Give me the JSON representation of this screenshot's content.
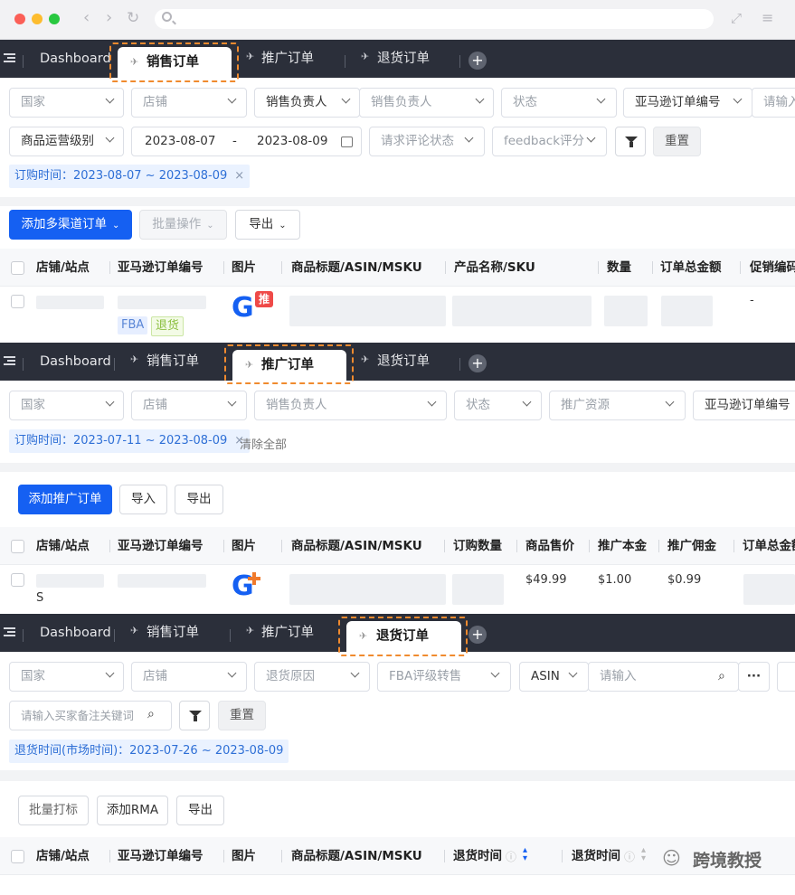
{
  "tabs": {
    "dashboard": "Dashboard",
    "sales": "销售订单",
    "promo": "推广订单",
    "returns": "退货订单"
  },
  "p1": {
    "f": [
      "国家",
      "店铺",
      "销售负责人",
      "销售负责人",
      "状态",
      "亚马逊订单编号",
      "请输入",
      "商品运营级别",
      "2023-08-07",
      "-",
      "2023-08-09",
      "请求评论状态",
      "feedback评分",
      "重置"
    ],
    "tag": "订购时间：2023-08-07 ~ 2023-08-09",
    "b": [
      "添加多渠道订单",
      "批量操作",
      "导出"
    ],
    "h": [
      "店铺/站点",
      "亚马逊订单编号",
      "图片",
      "商品标题/ASIN/MSKU",
      "产品名称/SKU",
      "数量",
      "订单总金额",
      "促销编码"
    ],
    "r": {
      "fba": "FBA",
      "ret": "退货",
      "badge": "推",
      "dash": "-"
    }
  },
  "p2": {
    "f": [
      "国家",
      "店铺",
      "销售负责人",
      "状态",
      "推广资源",
      "亚马逊订单编号"
    ],
    "tag": "订购时间：2023-07-11 ~ 2023-08-09",
    "clear": "清除全部",
    "b": [
      "添加推广订单",
      "导入",
      "导出"
    ],
    "h": [
      "店铺/站点",
      "亚马逊订单编号",
      "图片",
      "商品标题/ASIN/MSKU",
      "订购数量",
      "商品售价",
      "推广本金",
      "推广佣金",
      "订单总金额"
    ],
    "r": {
      "s": "S",
      "price": "$49.99",
      "principal": "$1.00",
      "comm": "$0.99"
    }
  },
  "p3": {
    "f": [
      "国家",
      "店铺",
      "退货原因",
      "FBA评级转售",
      "ASIN",
      "请输入",
      "请输入买家备注关键词",
      "重置"
    ],
    "tag": "退货时间(市场时间)：2023-07-26 ~ 2023-08-09",
    "b": [
      "批量打标",
      "添加RMA",
      "导出"
    ],
    "h": [
      "店铺/站点",
      "亚马逊订单编号",
      "图片",
      "商品标题/ASIN/MSKU",
      "退货时间",
      "退货时间"
    ]
  },
  "watermark": "跨境教授",
  "colors": {
    "tabbar": "#2b2f3a",
    "primary": "#1560f2",
    "highlight": "#f08a2e"
  }
}
